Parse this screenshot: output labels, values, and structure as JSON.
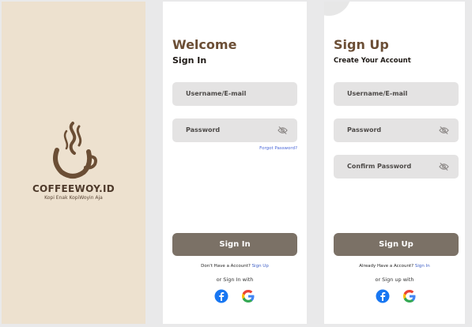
{
  "splash": {
    "brand": "COFFEEWOY.ID",
    "tagline": "Kopi Enak KopiWoyin Aja"
  },
  "signin": {
    "title": "Welcome",
    "subtitle": "Sign In",
    "username_placeholder": "Username/E-mail",
    "password_placeholder": "Password",
    "forgot": "Forgot Password?",
    "button": "Sign In",
    "account_prompt": "Don't Have a Account?",
    "account_link": "Sign Up",
    "social_label": "or Sign In with"
  },
  "signup": {
    "title": "Sign Up",
    "subtitle": "Create Your Account",
    "username_placeholder": "Username/E-mail",
    "password_placeholder": "Password",
    "confirm_placeholder": "Confirm Password",
    "button": "Sign Up",
    "account_prompt": "Already Have a Account?",
    "account_link": "Sign In",
    "social_label": "or Sign up with"
  },
  "icons": [
    "coffee-cup-logo-icon",
    "eye-off-icon",
    "facebook-icon",
    "google-icon"
  ],
  "colors": {
    "background": "#e9e9ea",
    "splash": "#ede1cf",
    "brown": "#6b4e35",
    "field": "#e4e3e3",
    "button": "#7b7166",
    "link": "#3f5fc6"
  }
}
